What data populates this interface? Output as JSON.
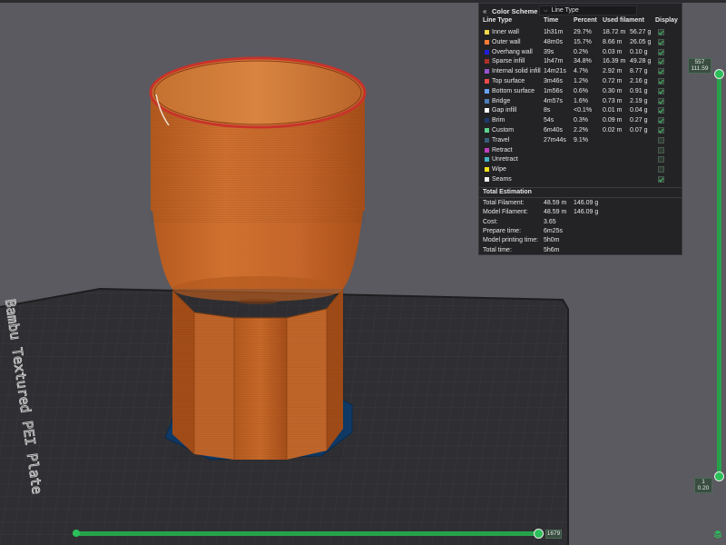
{
  "colors": {
    "background": "#5a5a60",
    "panel": "#232326",
    "plate": "#2f2f33",
    "model_orange": "#c96a29",
    "brim_blue": "#0f3a66",
    "slider_green": "#2bc05a"
  },
  "plate": {
    "label": "Bambu Textured PEI Plate"
  },
  "legend": {
    "scheme_title": "Color Scheme",
    "scheme_value": "Line Type",
    "columns": [
      "Line Type",
      "Time",
      "Percent",
      "Used filament",
      "Display"
    ],
    "rows": [
      {
        "name": "Inner wall",
        "time": "1h31m",
        "percent": "29.7%",
        "length": "18.72 m",
        "weight": "56.27 g",
        "color": "#f5d84a",
        "display": true
      },
      {
        "name": "Outer wall",
        "time": "48m0s",
        "percent": "15.7%",
        "length": "8.66 m",
        "weight": "26.05 g",
        "color": "#ff7d38",
        "display": true
      },
      {
        "name": "Overhang wall",
        "time": "39s",
        "percent": "0.2%",
        "length": "0.03 m",
        "weight": "0.10 g",
        "color": "#1f1fdb",
        "display": true
      },
      {
        "name": "Sparse infill",
        "time": "1h47m",
        "percent": "34.8%",
        "length": "16.39 m",
        "weight": "49.28 g",
        "color": "#b03029",
        "display": true
      },
      {
        "name": "Internal solid infill",
        "time": "14m21s",
        "percent": "4.7%",
        "length": "2.92 m",
        "weight": "8.77 g",
        "color": "#9654cc",
        "display": true
      },
      {
        "name": "Top surface",
        "time": "3m46s",
        "percent": "1.2%",
        "length": "0.72 m",
        "weight": "2.16 g",
        "color": "#f04a4a",
        "display": true
      },
      {
        "name": "Bottom surface",
        "time": "1m56s",
        "percent": "0.6%",
        "length": "0.30 m",
        "weight": "0.91 g",
        "color": "#66a3ff",
        "display": true
      },
      {
        "name": "Bridge",
        "time": "4m57s",
        "percent": "1.6%",
        "length": "0.73 m",
        "weight": "2.19 g",
        "color": "#4d80ba",
        "display": true
      },
      {
        "name": "Gap infill",
        "time": "8s",
        "percent": "<0.1%",
        "length": "0.01 m",
        "weight": "0.04 g",
        "color": "#ffffff",
        "display": true
      },
      {
        "name": "Brim",
        "time": "54s",
        "percent": "0.3%",
        "length": "0.09 m",
        "weight": "0.27 g",
        "color": "#1d3a6e",
        "display": true
      },
      {
        "name": "Custom",
        "time": "6m40s",
        "percent": "2.2%",
        "length": "0.02 m",
        "weight": "0.07 g",
        "color": "#5ed18f",
        "display": true
      },
      {
        "name": "Travel",
        "time": "27m44s",
        "percent": "9.1%",
        "length": "",
        "weight": "",
        "color": "#385e7a",
        "display": false
      },
      {
        "name": "Retract",
        "time": "",
        "percent": "",
        "length": "",
        "weight": "",
        "color": "#c03ec0",
        "display": false
      },
      {
        "name": "Unretract",
        "time": "",
        "percent": "",
        "length": "",
        "weight": "",
        "color": "#45b4c4",
        "display": false
      },
      {
        "name": "Wipe",
        "time": "",
        "percent": "",
        "length": "",
        "weight": "",
        "color": "#f2e21a",
        "display": false
      },
      {
        "name": "Seams",
        "time": "",
        "percent": "",
        "length": "",
        "weight": "",
        "color": "#f0f0f0",
        "display": true
      }
    ],
    "estimation": {
      "title": "Total Estimation",
      "rows": [
        {
          "label": "Total Filament:",
          "v1": "48.59 m",
          "v2": "146.09 g"
        },
        {
          "label": "Model Filament:",
          "v1": "48.59 m",
          "v2": "146.09 g"
        },
        {
          "label": "Cost:",
          "v1": "3.65",
          "v2": ""
        },
        {
          "label": "Prepare time:",
          "v1": "6m25s",
          "v2": ""
        },
        {
          "label": "Model printing time:",
          "v1": "5h0m",
          "v2": ""
        },
        {
          "label": "Total time:",
          "v1": "5h6m",
          "v2": ""
        }
      ]
    }
  },
  "vertical_slider": {
    "top_layer": "557",
    "top_height": "111.59",
    "bottom_layer": "1",
    "bottom_height": "0.20"
  },
  "horizontal_slider": {
    "value": "1679"
  }
}
